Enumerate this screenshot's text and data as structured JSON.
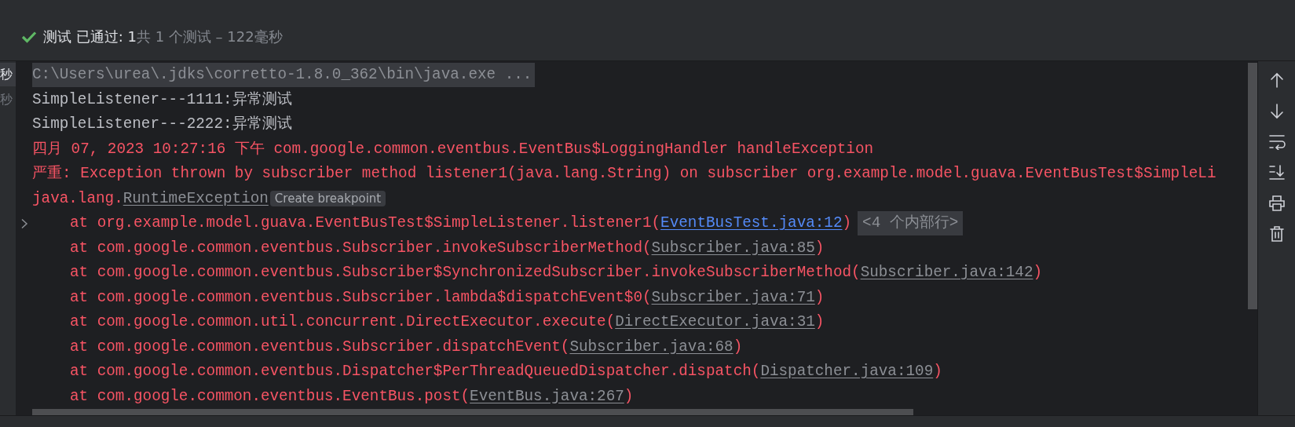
{
  "header": {
    "passed_label": "测试 已通过: 1",
    "summary": "共 1 个测试 – 122毫秒"
  },
  "left_strip": {
    "items": [
      {
        "text": "秒",
        "selected": true
      },
      {
        "text": "秒",
        "selected": false
      }
    ]
  },
  "console": {
    "lines": [
      {
        "kind": "command",
        "expandable": false,
        "segments": [
          {
            "kind": "plain",
            "text": "C:\\Users\\urea\\.jdks\\corretto-1.8.0_362\\bin\\java.exe ..."
          }
        ]
      },
      {
        "kind": "output",
        "expandable": false,
        "segments": [
          {
            "kind": "plain",
            "text": "SimpleListener---1111:异常测试"
          }
        ]
      },
      {
        "kind": "output",
        "expandable": false,
        "segments": [
          {
            "kind": "plain",
            "text": "SimpleListener---2222:异常测试"
          }
        ]
      },
      {
        "kind": "error",
        "expandable": false,
        "segments": [
          {
            "kind": "plain",
            "text": "四月 07, 2023 10:27:16 下午 com.google.common.eventbus.EventBus$LoggingHandler handleException"
          }
        ]
      },
      {
        "kind": "error",
        "expandable": false,
        "segments": [
          {
            "kind": "plain",
            "text": "严重: Exception thrown by subscriber method listener1(java.lang.String) on subscriber org.example.model.guava.EventBusTest$SimpleLi"
          }
        ]
      },
      {
        "kind": "error",
        "expandable": false,
        "segments": [
          {
            "kind": "plain",
            "text": "java.lang."
          },
          {
            "kind": "library-link",
            "text": "RuntimeException"
          },
          {
            "kind": "hint",
            "text": "Create breakpoint"
          }
        ]
      },
      {
        "kind": "stack",
        "expandable": true,
        "segments": [
          {
            "kind": "plain",
            "text": "at org.example.model.guava.EventBusTest$SimpleListener.listener1("
          },
          {
            "kind": "source-link",
            "text": "EventBusTest.java:12"
          },
          {
            "kind": "plain",
            "text": ")"
          },
          {
            "kind": "fold",
            "text": "<4 个内部行>"
          }
        ]
      },
      {
        "kind": "stack",
        "expandable": false,
        "segments": [
          {
            "kind": "plain",
            "text": "at com.google.common.eventbus.Subscriber.invokeSubscriberMethod("
          },
          {
            "kind": "library-link",
            "text": "Subscriber.java:85"
          },
          {
            "kind": "plain",
            "text": ")"
          }
        ]
      },
      {
        "kind": "stack",
        "expandable": false,
        "segments": [
          {
            "kind": "plain",
            "text": "at com.google.common.eventbus.Subscriber$SynchronizedSubscriber.invokeSubscriberMethod("
          },
          {
            "kind": "library-link",
            "text": "Subscriber.java:142"
          },
          {
            "kind": "plain",
            "text": ")"
          }
        ]
      },
      {
        "kind": "stack",
        "expandable": false,
        "segments": [
          {
            "kind": "plain",
            "text": "at com.google.common.eventbus.Subscriber.lambda$dispatchEvent$0("
          },
          {
            "kind": "library-link",
            "text": "Subscriber.java:71"
          },
          {
            "kind": "plain",
            "text": ")"
          }
        ]
      },
      {
        "kind": "stack",
        "expandable": false,
        "segments": [
          {
            "kind": "plain",
            "text": "at com.google.common.util.concurrent.DirectExecutor.execute("
          },
          {
            "kind": "library-link",
            "text": "DirectExecutor.java:31"
          },
          {
            "kind": "plain",
            "text": ")"
          }
        ]
      },
      {
        "kind": "stack",
        "expandable": false,
        "segments": [
          {
            "kind": "plain",
            "text": "at com.google.common.eventbus.Subscriber.dispatchEvent("
          },
          {
            "kind": "library-link",
            "text": "Subscriber.java:68"
          },
          {
            "kind": "plain",
            "text": ")"
          }
        ]
      },
      {
        "kind": "stack",
        "expandable": false,
        "segments": [
          {
            "kind": "plain",
            "text": "at com.google.common.eventbus.Dispatcher$PerThreadQueuedDispatcher.dispatch("
          },
          {
            "kind": "library-link",
            "text": "Dispatcher.java:109"
          },
          {
            "kind": "plain",
            "text": ")"
          }
        ]
      },
      {
        "kind": "stack",
        "expandable": false,
        "segments": [
          {
            "kind": "plain",
            "text": "at com.google.common.eventbus.EventBus.post("
          },
          {
            "kind": "library-link",
            "text": "EventBus.java:267"
          },
          {
            "kind": "plain",
            "text": ")"
          }
        ]
      }
    ]
  }
}
